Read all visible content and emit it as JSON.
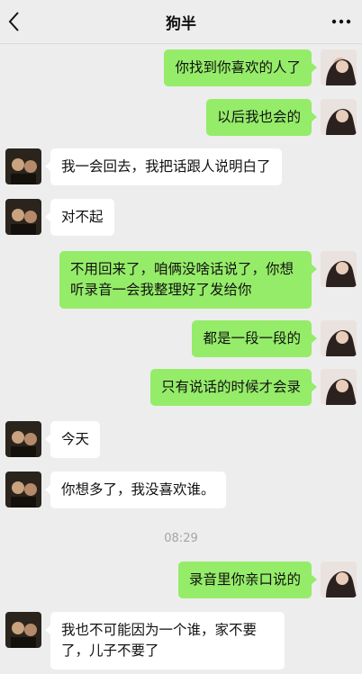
{
  "header": {
    "title": "狗半"
  },
  "messages": [
    {
      "text": "你找到你喜欢的人了"
    },
    {
      "text": "以后我也会的"
    },
    {
      "text": "我一会回去，我把话跟人说明白了"
    },
    {
      "text": "对不起"
    },
    {
      "text": "不用回来了，咱俩没啥话说了，你想听录音一会我整理好了发给你"
    },
    {
      "text": "都是一段一段的"
    },
    {
      "text": "只有说话的时候才会录"
    },
    {
      "text": "今天"
    },
    {
      "text": "你想多了，我没喜欢谁。"
    },
    {
      "text": "录音里你亲口说的"
    },
    {
      "text": "我也不可能因为一个谁，家不要了，儿子不要了"
    }
  ],
  "timestamp": "08:29",
  "colors": {
    "self_bubble": "#95ec69",
    "other_bubble": "#ffffff",
    "background": "#ededed"
  }
}
